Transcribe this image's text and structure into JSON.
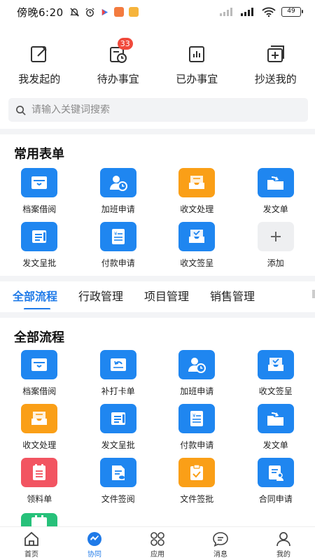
{
  "status_bar": {
    "time": "傍晚6:20",
    "battery": "49"
  },
  "quick_entries": [
    {
      "label": "我发起的",
      "icon": "edit-document-icon"
    },
    {
      "label": "待办事宜",
      "icon": "pending-clock-icon",
      "badge": "33"
    },
    {
      "label": "已办事宜",
      "icon": "bar-chart-document-icon"
    },
    {
      "label": "抄送我的",
      "icon": "copy-add-icon"
    }
  ],
  "search": {
    "placeholder": "请输入关键词搜索"
  },
  "common_forms": {
    "title": "常用表单",
    "items": [
      {
        "label": "档案借阅",
        "icon": "archive-box-icon",
        "color": "#1f86f0"
      },
      {
        "label": "加班申请",
        "icon": "user-clock-icon",
        "color": "#1f86f0"
      },
      {
        "label": "收文处理",
        "icon": "inbox-tray-icon",
        "color": "#fa9f17"
      },
      {
        "label": "发文单",
        "icon": "folder-send-icon",
        "color": "#1f86f0"
      },
      {
        "label": "发文呈批",
        "icon": "document-lines-icon",
        "color": "#1f86f0"
      },
      {
        "label": "付款申请",
        "icon": "payment-list-icon",
        "color": "#1f86f0"
      },
      {
        "label": "收文签呈",
        "icon": "inbox-check-icon",
        "color": "#1f86f0"
      },
      {
        "label": "添加",
        "icon": "plus-icon",
        "color": "#eeeff1"
      }
    ]
  },
  "tabs": [
    "全部流程",
    "行政管理",
    "项目管理",
    "销售管理"
  ],
  "all_flows": {
    "title": "全部流程",
    "items": [
      {
        "label": "档案借阅",
        "icon": "archive-box-icon",
        "color": "#1f86f0"
      },
      {
        "label": "补打卡单",
        "icon": "punch-card-icon",
        "color": "#1f86f0"
      },
      {
        "label": "加班申请",
        "icon": "user-clock-icon",
        "color": "#1f86f0"
      },
      {
        "label": "收文签呈",
        "icon": "inbox-check-icon",
        "color": "#1f86f0"
      },
      {
        "label": "收文处理",
        "icon": "inbox-tray-icon",
        "color": "#fa9f17"
      },
      {
        "label": "发文呈批",
        "icon": "document-lines-icon",
        "color": "#1f86f0"
      },
      {
        "label": "付款申请",
        "icon": "payment-list-icon",
        "color": "#1f86f0"
      },
      {
        "label": "发文单",
        "icon": "folder-send-icon",
        "color": "#1f86f0"
      },
      {
        "label": "领料单",
        "icon": "material-list-icon",
        "color": "#f25461"
      },
      {
        "label": "文件签阅",
        "icon": "file-sign-icon",
        "color": "#1f86f0"
      },
      {
        "label": "文件签批",
        "icon": "clipboard-check-icon",
        "color": "#fa9f17"
      },
      {
        "label": "合同申请",
        "icon": "contract-user-icon",
        "color": "#1f86f0"
      }
    ]
  },
  "bottom_nav": [
    {
      "label": "首页",
      "icon": "home-icon"
    },
    {
      "label": "协同",
      "icon": "handshake-icon",
      "active": true
    },
    {
      "label": "应用",
      "icon": "apps-grid-icon"
    },
    {
      "label": "消息",
      "icon": "message-icon"
    },
    {
      "label": "我的",
      "icon": "person-icon"
    }
  ]
}
